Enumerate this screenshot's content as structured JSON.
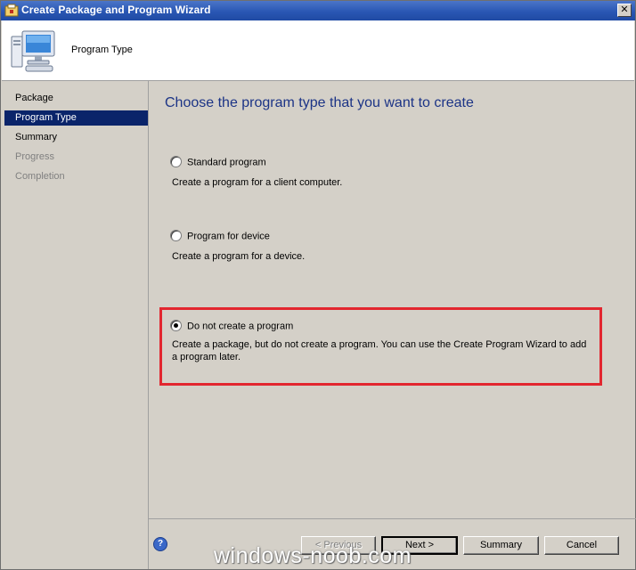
{
  "window": {
    "title": "Create Package and Program Wizard",
    "close_glyph": "✕"
  },
  "header": {
    "title": "Program Type"
  },
  "nav": [
    {
      "label": "Package",
      "state": "normal"
    },
    {
      "label": "Program Type",
      "state": "active"
    },
    {
      "label": "Summary",
      "state": "normal"
    },
    {
      "label": "Progress",
      "state": "disabled"
    },
    {
      "label": "Completion",
      "state": "disabled"
    }
  ],
  "main": {
    "heading": "Choose the program type that you want to create",
    "options": [
      {
        "label": "Standard program",
        "description": "Create a program for a client computer.",
        "selected": false
      },
      {
        "label": "Program for device",
        "description": "Create a program for a device.",
        "selected": false
      },
      {
        "label": "Do not create a program",
        "description": "Create a package, but do not create a program. You can use the Create Program Wizard to add a program later.",
        "selected": true
      }
    ]
  },
  "footer": {
    "help_glyph": "?",
    "previous_label": "< Previous",
    "next_label": "Next >",
    "summary_label": "Summary",
    "cancel_label": "Cancel"
  },
  "watermark": "windows-noob.com",
  "colors": {
    "accent": "#0a246a",
    "heading": "#1c3486",
    "highlight": "#e2262f",
    "titlebar": "#2a57b4"
  }
}
